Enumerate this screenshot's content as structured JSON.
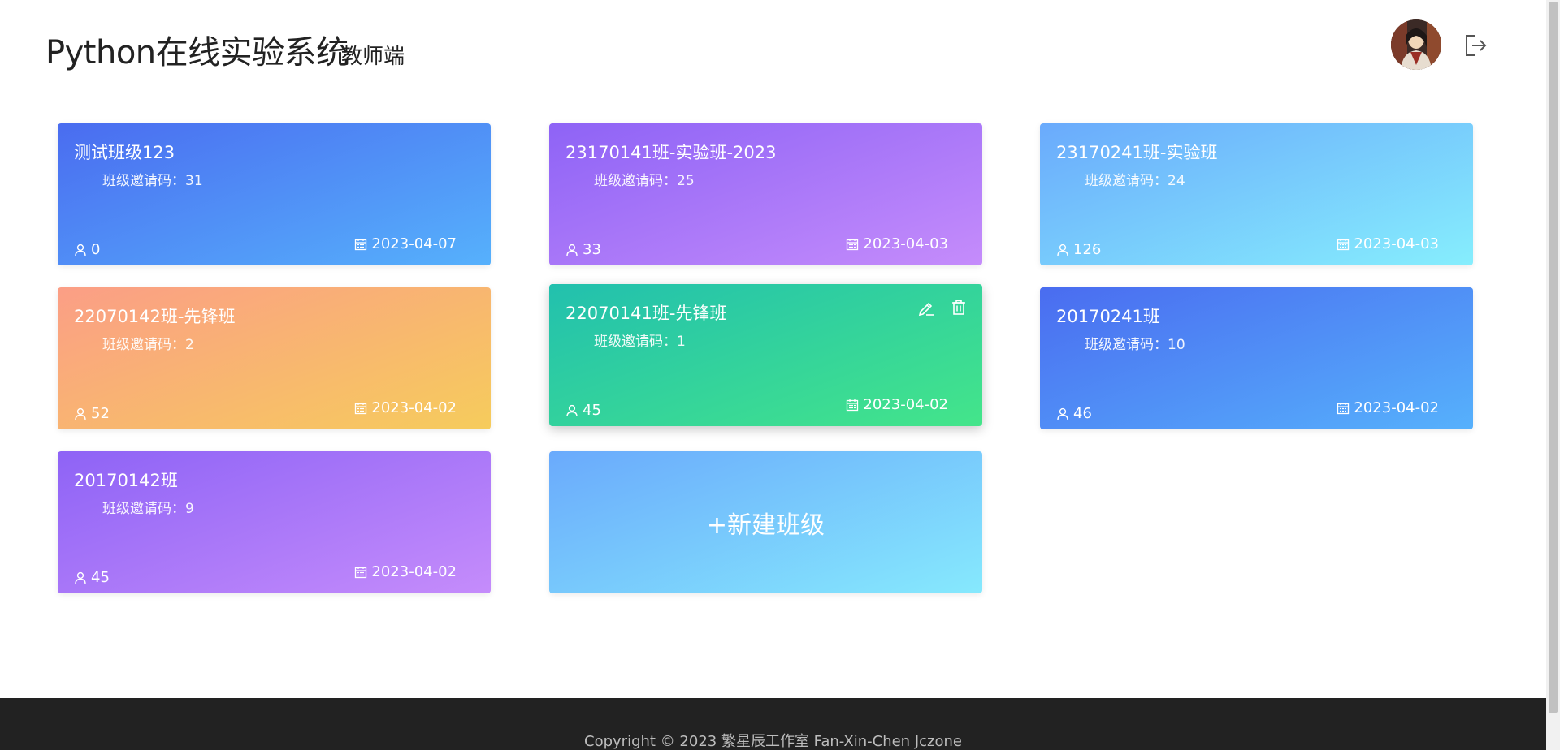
{
  "header": {
    "app_title": "Python在线实验系统",
    "app_subtitle": "教师端",
    "avatar_icon": "avatar-icon",
    "logout_icon": "logout-icon"
  },
  "classes": [
    {
      "name": "测试班级123",
      "invite_label": "班级邀请码：",
      "invite_code": "31",
      "members": "0",
      "date": "2023-04-07",
      "gradient": [
        "#4a6cf0",
        "#56b1fc"
      ]
    },
    {
      "name": "23170141班-实验班-2023",
      "invite_label": "班级邀请码：",
      "invite_code": "25",
      "members": "33",
      "date": "2023-04-03",
      "gradient": [
        "#8e63f6",
        "#c58cfb"
      ]
    },
    {
      "name": "23170241班-实验班",
      "invite_label": "班级邀请码：",
      "invite_code": "24",
      "members": "126",
      "date": "2023-04-03",
      "gradient": [
        "#6aaafc",
        "#86eefd"
      ]
    },
    {
      "name": "22070142班-先锋班",
      "invite_label": "班级邀请码：",
      "invite_code": "2",
      "members": "52",
      "date": "2023-04-02",
      "gradient": [
        "#fb9e86",
        "#f6cc5c"
      ]
    },
    {
      "name": "22070141班-先锋班",
      "invite_label": "班级邀请码：",
      "invite_code": "1",
      "members": "45",
      "date": "2023-04-02",
      "gradient": [
        "#22c0ae",
        "#44e58a"
      ],
      "hovered": true
    },
    {
      "name": "20170241班",
      "invite_label": "班级邀请码：",
      "invite_code": "10",
      "members": "46",
      "date": "2023-04-02",
      "gradient": [
        "#4a6cf0",
        "#56b1fc"
      ]
    },
    {
      "name": "20170142班",
      "invite_label": "班级邀请码：",
      "invite_code": "9",
      "members": "45",
      "date": "2023-04-02",
      "gradient": [
        "#8e63f6",
        "#c58cfb"
      ]
    }
  ],
  "new_class_label": "+新建班级",
  "footer": {
    "copyright": "Copyright © 2023 繁星辰工作室 Fan-Xin-Chen Jczone"
  },
  "icons": {
    "members": "user-icon",
    "date": "calendar-icon",
    "edit": "edit-icon",
    "delete": "trash-icon"
  }
}
